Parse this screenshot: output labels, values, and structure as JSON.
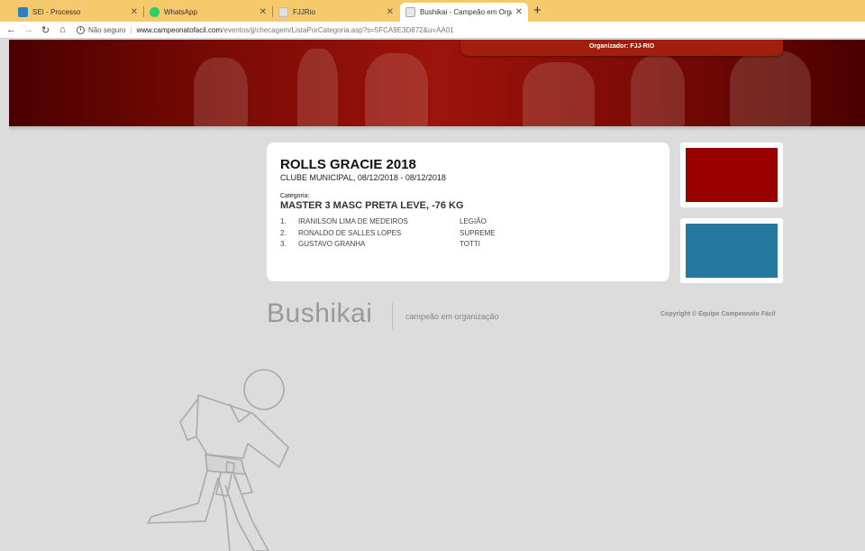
{
  "browser": {
    "tabs": [
      {
        "title": "SEI - Processo",
        "active": false,
        "favicon_color": "#2f7fbf"
      },
      {
        "title": "WhatsApp",
        "active": false,
        "favicon_color": "#25d366"
      },
      {
        "title": "FJJRio",
        "active": false,
        "favicon_color": "#e0e0e0"
      },
      {
        "title": "Bushikai - Campeão em Organiza...",
        "active": true,
        "favicon_color": "#e8e8e8"
      }
    ],
    "new_tab": "+",
    "close_glyph": "✕",
    "nav": {
      "back": "←",
      "forward": "→",
      "reload": "↻",
      "home": "⌂"
    },
    "security_text": "Não seguro",
    "url_host": "www.campeonatofacil.com",
    "url_path": "/eventos/jj/checagem/ListaPorCategoria.asp?s=5FCA9E3D872&u=AA01"
  },
  "banner": {
    "organizer": "Organizador: FJJ-RIO",
    "accent_color": "#9c140b"
  },
  "event": {
    "title": "ROLLS GRACIE 2018",
    "subtitle": "CLUBE MUNICIPAL, 08/12/2018 - 08/12/2018",
    "category_label": "Categoria:",
    "category_name": "MASTER 3 MASC PRETA LEVE, -76 KG",
    "results": [
      {
        "pos": "1.",
        "athlete": "IRANILSON LIMA DE MEDEIROS",
        "team": "LEGIÃO"
      },
      {
        "pos": "2.",
        "athlete": "RONALDO DE SALLES LOPES",
        "team": "SUPREME"
      },
      {
        "pos": "3.",
        "athlete": "GUSTAVO GRANHA",
        "team": "TOTTI"
      }
    ]
  },
  "side_panels": [
    {
      "color": "#990000"
    },
    {
      "color": "#26799e"
    }
  ],
  "footer": {
    "brand": "Bushikai",
    "tagline": "campeão em organização",
    "copyright": "Copyright © Equipe Campeonato Fácil"
  }
}
